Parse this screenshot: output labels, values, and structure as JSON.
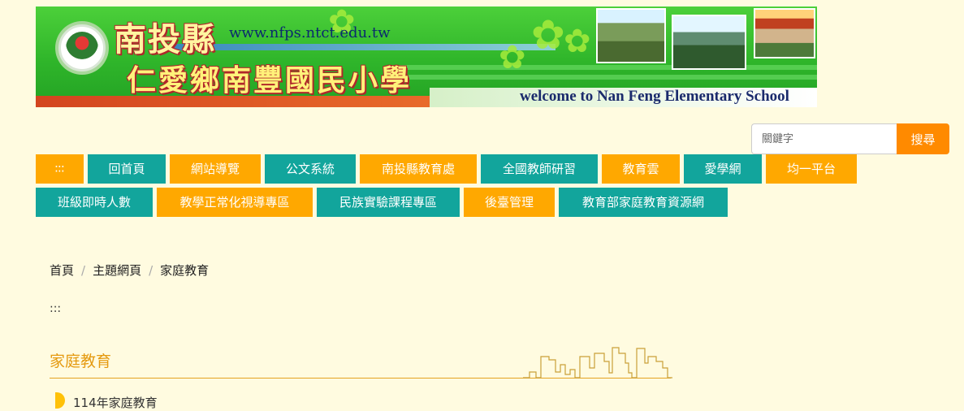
{
  "banner": {
    "title_line1": "南投縣",
    "url": "www.nfps.ntct.edu.tw",
    "title_line2": "仁愛鄉南豐國民小學",
    "welcome": "welcome to Nan Feng Elementary School"
  },
  "search": {
    "placeholder": "關鍵字",
    "button_label": "搜尋"
  },
  "nav": {
    "row1": [
      "∶∶∶",
      "回首頁",
      "網站導覽",
      "公文系統",
      "南投縣教育處",
      "全國教師研習",
      "教育雲",
      "愛學網",
      "均一平台"
    ],
    "row2": [
      "班級即時人數",
      "教學正常化視導專區",
      "民族實驗課程專區",
      "後臺管理",
      "教育部家庭教育資源網"
    ]
  },
  "colors": {
    "orange": "#ffa800",
    "teal": "#12a59c",
    "accent": "#e59a10",
    "search_button": "#ff8a00",
    "background": "#fffbe0"
  },
  "breadcrumb": {
    "items": [
      "首頁",
      "主題網頁",
      "家庭教育"
    ],
    "separator": "/"
  },
  "accesskey": ":::",
  "section": {
    "title": "家庭教育",
    "items": [
      "114年家庭教育"
    ]
  }
}
